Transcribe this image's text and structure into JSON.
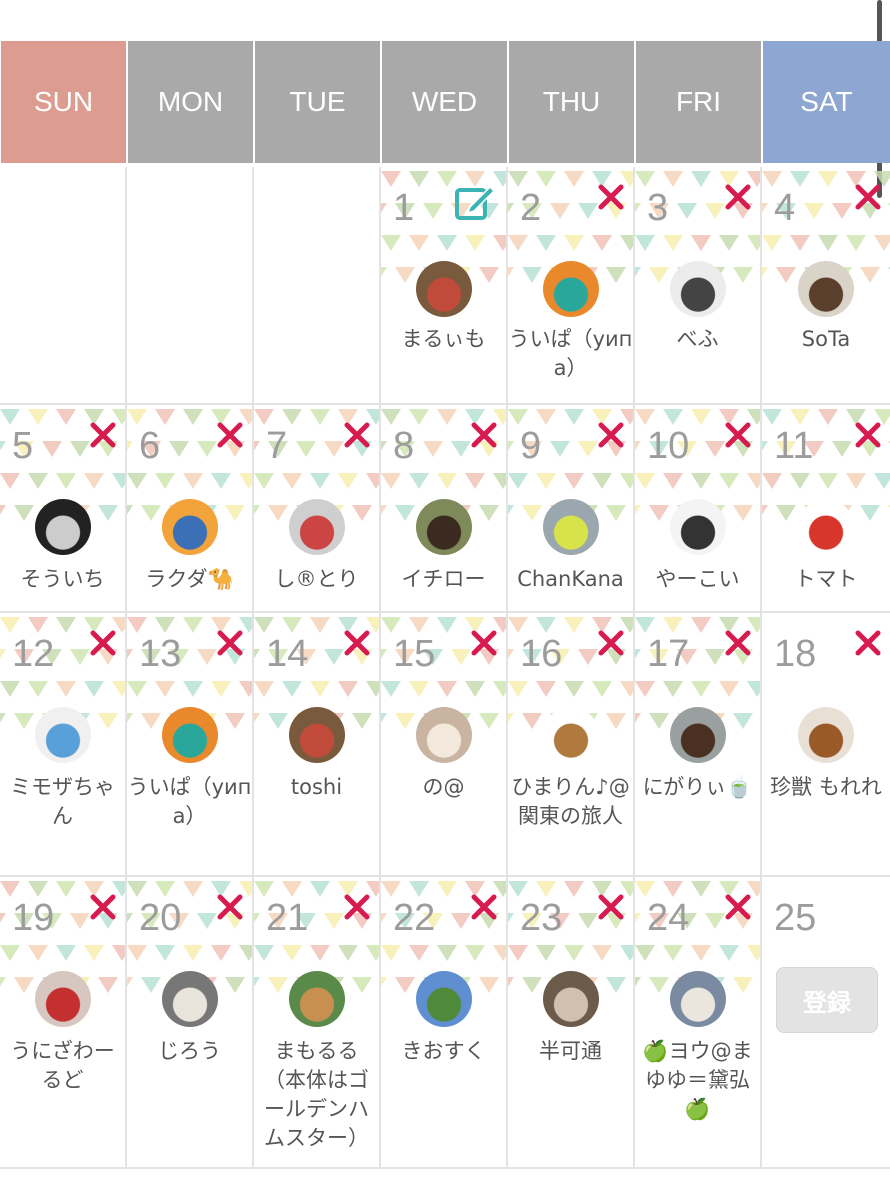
{
  "weekdays": [
    "SUN",
    "MON",
    "TUE",
    "WED",
    "THU",
    "FRI",
    "SAT"
  ],
  "colors": {
    "sun": "#dc9c90",
    "sat": "#8ea6d2",
    "weekday": "#a9a9a9",
    "xmark": "#d81b4f",
    "edit": "#3cb4b4",
    "daynum": "#9c9c9c"
  },
  "register_label": "登録",
  "weeks": [
    [
      {
        "day": "",
        "empty": true
      },
      {
        "day": "",
        "empty": true
      },
      {
        "day": "",
        "empty": true
      },
      {
        "day": "1",
        "icon": "edit-icon",
        "name": "まるぃも",
        "avatar": "horse-racing-photo"
      },
      {
        "day": "2",
        "icon": "x-icon",
        "name": "ういぱ（уипа）",
        "avatar": "orange-badge"
      },
      {
        "day": "3",
        "icon": "x-icon",
        "name": "べふ",
        "avatar": "horse-sketch"
      },
      {
        "day": "4",
        "icon": "x-icon",
        "name": "SoTa",
        "avatar": "horse-photo"
      }
    ],
    [
      {
        "day": "5",
        "icon": "x-icon",
        "name": "そういち",
        "avatar": "dark-photo"
      },
      {
        "day": "6",
        "icon": "x-icon",
        "name": "ラクダ🐪",
        "avatar": "camel-illustration"
      },
      {
        "day": "7",
        "icon": "x-icon",
        "name": "し®とり",
        "avatar": "statue-photo"
      },
      {
        "day": "8",
        "icon": "x-icon",
        "name": "イチロー",
        "avatar": "horse-track-photo"
      },
      {
        "day": "9",
        "icon": "x-icon",
        "name": "ChanKana",
        "avatar": "parakeet-photo"
      },
      {
        "day": "10",
        "icon": "x-icon",
        "name": "やーこい",
        "avatar": "people-sketch"
      },
      {
        "day": "11",
        "icon": "x-icon",
        "name": "トマト",
        "avatar": "tomato-character"
      }
    ],
    [
      {
        "day": "12",
        "icon": "x-icon",
        "name": "ミモザちゃん",
        "avatar": "cartoon-character"
      },
      {
        "day": "13",
        "icon": "x-icon",
        "name": "ういぱ（уипа）",
        "avatar": "orange-badge"
      },
      {
        "day": "14",
        "icon": "x-icon",
        "name": "toshi",
        "avatar": "horse-racing-photo"
      },
      {
        "day": "15",
        "icon": "x-icon",
        "name": "の@",
        "avatar": "hedgehog-photo"
      },
      {
        "day": "16",
        "icon": "x-icon",
        "name": "ひまりん♪@関東の旅人",
        "avatar": "horse-cartoon"
      },
      {
        "day": "17",
        "icon": "x-icon",
        "name": "にがりぃ🍵",
        "avatar": "horse-closeup-photo"
      },
      {
        "day": "18",
        "icon": "x-icon",
        "name": "珍獣 もれれ",
        "avatar": "horse-mask-photo"
      }
    ],
    [
      {
        "day": "19",
        "icon": "x-icon",
        "name": "うにざわーるど",
        "avatar": "figure-photo"
      },
      {
        "day": "20",
        "icon": "x-icon",
        "name": "じろう",
        "avatar": "white-horse-photo"
      },
      {
        "day": "21",
        "icon": "x-icon",
        "name": "まもるる（本体はゴールデンハムスター）",
        "avatar": "hamster-photo"
      },
      {
        "day": "22",
        "icon": "x-icon",
        "name": "きおすく",
        "avatar": "horse-field-photo"
      },
      {
        "day": "23",
        "icon": "x-icon",
        "name": "半可通",
        "avatar": "dog-photo"
      },
      {
        "day": "24",
        "icon": "x-icon",
        "name": "🍏ヨウ@まゆゆ＝黛弘🍏",
        "avatar": "crowd-photo"
      },
      {
        "day": "25",
        "register": true
      }
    ]
  ]
}
